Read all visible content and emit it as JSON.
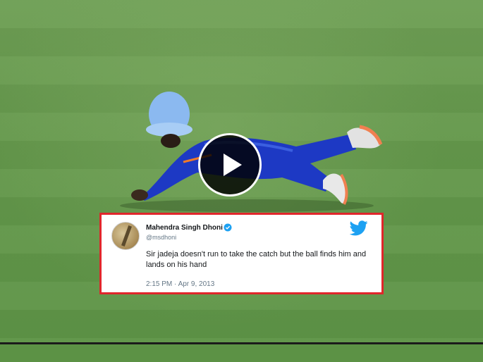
{
  "video": {
    "play_icon": "play-icon"
  },
  "tweet": {
    "author_name": "Mahendra Singh Dhoni",
    "handle": "@msdhoni",
    "verified": true,
    "text": "Sir jadeja doesn't run to take the catch but the ball finds him and lands on his hand",
    "timestamp": "2:15 PM · Apr 9, 2013",
    "brand_icon": "twitter-bird-icon",
    "accent_color": "#1da1f2",
    "border_color": "#e0262b"
  }
}
